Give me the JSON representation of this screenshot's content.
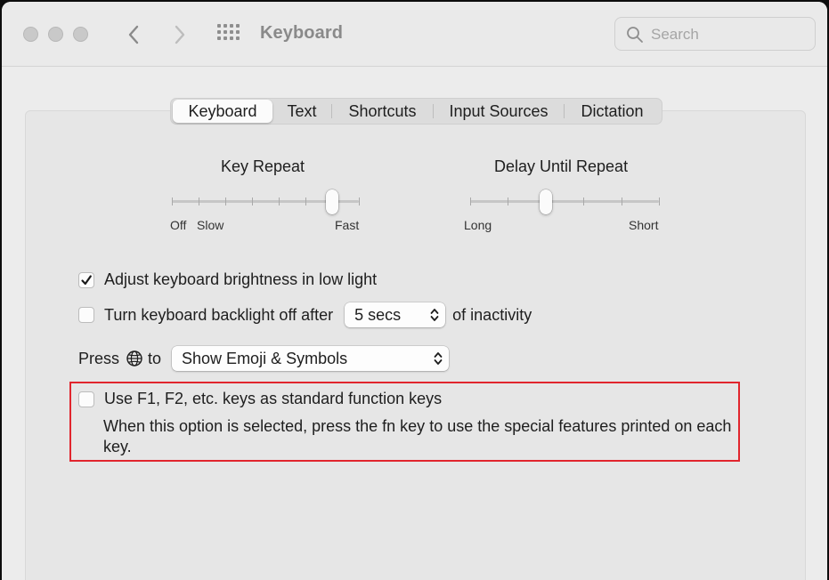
{
  "window": {
    "title": "Keyboard",
    "search_placeholder": "Search"
  },
  "tabs": [
    {
      "label": "Keyboard",
      "selected": true
    },
    {
      "label": "Text",
      "selected": false
    },
    {
      "label": "Shortcuts",
      "selected": false
    },
    {
      "label": "Input Sources",
      "selected": false
    },
    {
      "label": "Dictation",
      "selected": false
    }
  ],
  "key_repeat": {
    "title": "Key Repeat",
    "label_off": "Off",
    "label_slow": "Slow",
    "label_fast": "Fast",
    "stops": 8,
    "selected_stop": 7
  },
  "delay_until_repeat": {
    "title": "Delay Until Repeat",
    "label_long": "Long",
    "label_short": "Short",
    "stops": 6,
    "selected_stop": 3
  },
  "options": {
    "brightness_label": "Adjust keyboard brightness in low light",
    "brightness_checked": true,
    "backlight_label": "Turn keyboard backlight off after",
    "backlight_checked": false,
    "backlight_value": "5 secs",
    "backlight_suffix": "of inactivity",
    "press_label": "Press",
    "press_to": "to",
    "press_value": "Show Emoji & Symbols",
    "fn_label": "Use F1, F2, etc. keys as standard function keys",
    "fn_checked": false,
    "fn_description": "When this option is selected, press the fn key to use the special features printed on each key."
  },
  "colors": {
    "highlight": "#e1252d"
  }
}
